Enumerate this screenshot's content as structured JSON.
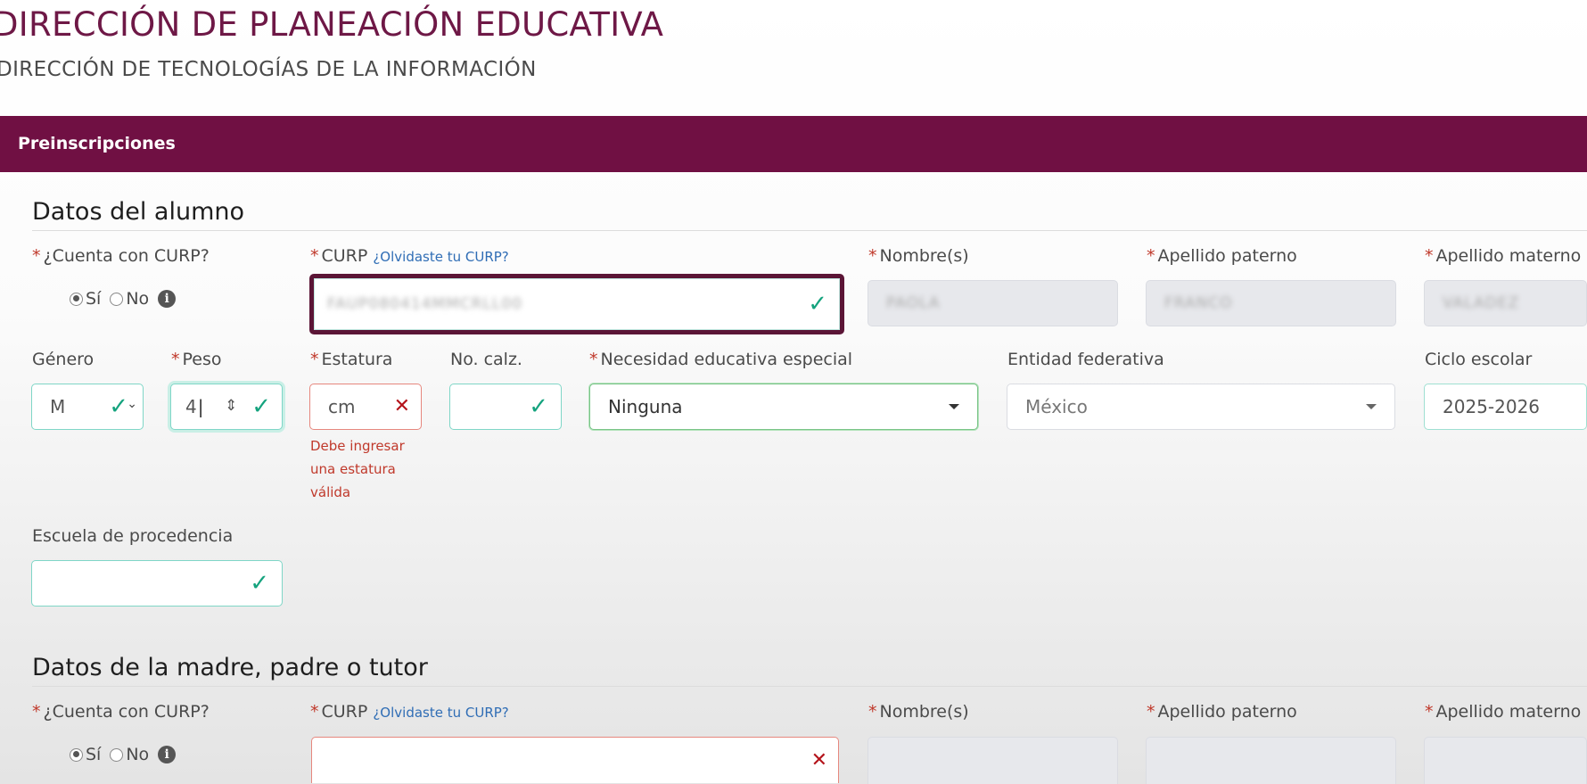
{
  "header": {
    "title": "DIRECCIÓN DE PLANEACIÓN EDUCATIVA",
    "subtitle": "DIRECCIÓN DE TECNOLOGÍAS DE LA INFORMACIÓN"
  },
  "band": {
    "title": "Preinscripciones"
  },
  "alumno": {
    "section_title": "Datos del alumno",
    "has_curp_label": "¿Cuenta con CURP?",
    "radio_yes": "Sí",
    "radio_no": "No",
    "curp_label": "CURP",
    "curp_link": "¿Olvidaste tu CURP?",
    "curp_value": "FAUP080414MMCRLL00",
    "nombre_label": "Nombre(s)",
    "nombre_value": "PAOLA",
    "paterno_label": "Apellido paterno",
    "paterno_value": "FRANCO",
    "materno_label": "Apellido materno",
    "materno_value": "VALADEZ",
    "genero_label": "Género",
    "genero_value": "M",
    "peso_label": "Peso",
    "peso_value": "4",
    "estatura_label": "Estatura",
    "estatura_value": "cm",
    "estatura_error": [
      "Debe ingresar",
      "una estatura",
      "válida"
    ],
    "calzado_label": "No. calz.",
    "calzado_value": "",
    "necesidad_label": "Necesidad educativa especial",
    "necesidad_value": "Ninguna",
    "entidad_label": "Entidad federativa",
    "entidad_value": "México",
    "ciclo_label": "Ciclo escolar",
    "ciclo_value": "2025-2026",
    "escuela_label": "Escuela de procedencia",
    "escuela_value": ""
  },
  "tutor": {
    "section_title": "Datos de la madre, padre o tutor",
    "has_curp_label": "¿Cuenta con CURP?",
    "radio_yes": "Sí",
    "radio_no": "No",
    "curp_label": "CURP",
    "curp_link": "¿Olvidaste tu CURP?",
    "curp_value": "",
    "nombre_label": "Nombre(s)",
    "paterno_label": "Apellido paterno",
    "materno_label": "Apellido materno"
  },
  "icons": {
    "valid": "check-icon",
    "invalid": "x-icon",
    "info": "info-icon",
    "dropdown": "caret-down-icon"
  },
  "colors": {
    "brand": "#701043",
    "heading": "#6e1846",
    "valid": "#15a37e",
    "error": "#c0392b",
    "link": "#2f6db5"
  }
}
